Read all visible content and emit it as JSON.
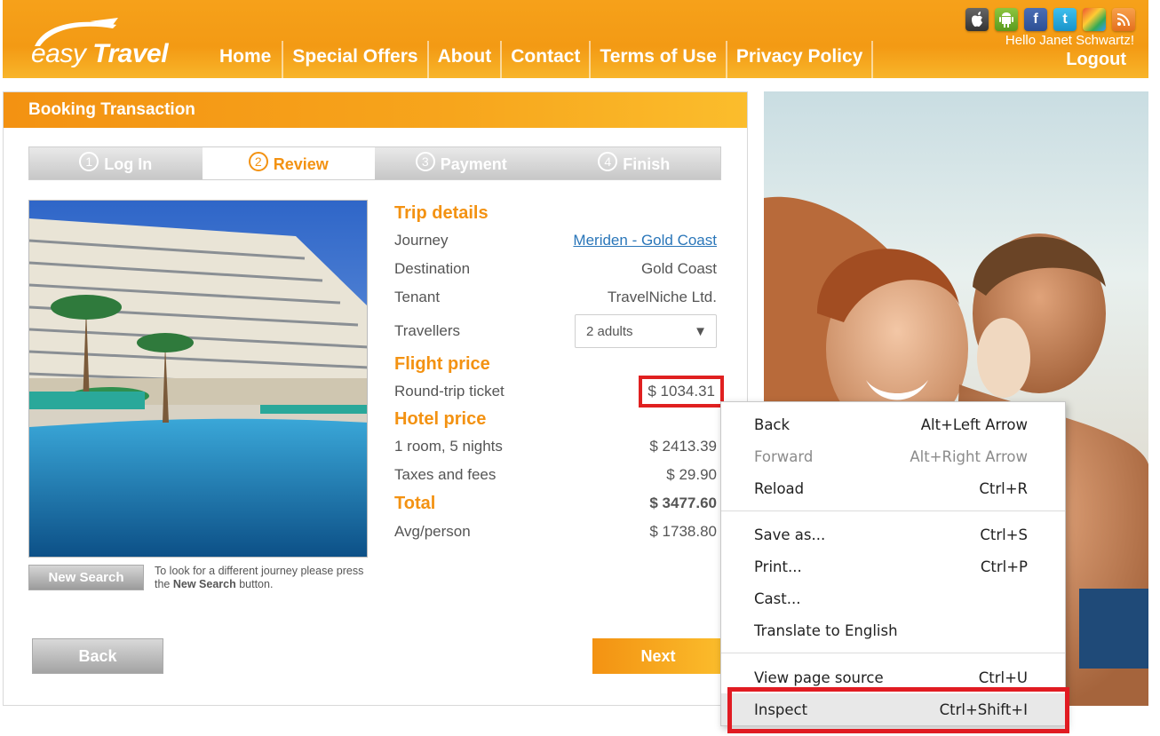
{
  "header": {
    "logo_word1": "easy",
    "logo_word2": "Travel",
    "nav": [
      "Home",
      "Special Offers",
      "About",
      "Contact",
      "Terms of Use",
      "Privacy Policy"
    ],
    "greeting": "Hello Janet Schwartz!",
    "logout": "Logout",
    "social_icons": [
      "apple-icon",
      "android-icon",
      "facebook-icon",
      "twitter-icon",
      "multicolor-icon",
      "rss-icon"
    ],
    "brand_color": "#f39212"
  },
  "booking": {
    "title": "Booking Transaction",
    "steps": [
      {
        "num": "1",
        "label": "Log In",
        "active": false
      },
      {
        "num": "2",
        "label": "Review",
        "active": true
      },
      {
        "num": "3",
        "label": "Payment",
        "active": false
      },
      {
        "num": "4",
        "label": "Finish",
        "active": false
      }
    ],
    "trip": {
      "title": "Trip details",
      "journey_label": "Journey",
      "journey_value": "Meriden - Gold Coast",
      "destination_label": "Destination",
      "destination_value": "Gold Coast",
      "tenant_label": "Tenant",
      "tenant_value": "TravelNiche Ltd.",
      "travellers_label": "Travellers",
      "travellers_value": "2 adults"
    },
    "flight": {
      "title": "Flight price",
      "ticket_label": "Round-trip ticket",
      "ticket_value": "$ 1034.31"
    },
    "hotel": {
      "title": "Hotel price",
      "room_label": "1 room, 5 nights",
      "room_value": "$ 2413.39",
      "taxes_label": "Taxes and fees",
      "taxes_value": "$ 29.90"
    },
    "total": {
      "title": "Total",
      "total_value": "$ 3477.60",
      "avg_label": "Avg/person",
      "avg_value": "$ 1738.80"
    },
    "new_search": "New Search",
    "hint_pre": "To look for a different journey please press the ",
    "hint_bold": "New Search",
    "hint_post": " button.",
    "back": "Back",
    "next": "Next"
  },
  "context_menu": [
    {
      "label": "Back",
      "shortcut": "Alt+Left Arrow",
      "disabled": false
    },
    {
      "label": "Forward",
      "shortcut": "Alt+Right Arrow",
      "disabled": true
    },
    {
      "label": "Reload",
      "shortcut": "Ctrl+R",
      "disabled": false
    },
    {
      "label": "Save as...",
      "shortcut": "Ctrl+S",
      "disabled": false
    },
    {
      "label": "Print...",
      "shortcut": "Ctrl+P",
      "disabled": false
    },
    {
      "label": "Cast...",
      "shortcut": "",
      "disabled": false
    },
    {
      "label": "Translate to English",
      "shortcut": "",
      "disabled": false
    },
    {
      "label": "View page source",
      "shortcut": "Ctrl+U",
      "disabled": false
    },
    {
      "label": "Inspect",
      "shortcut": "Ctrl+Shift+I",
      "disabled": false
    }
  ],
  "highlight_color": "#e11b22"
}
